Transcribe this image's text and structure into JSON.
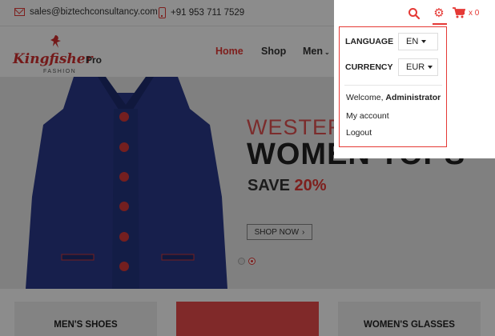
{
  "topbar": {
    "email": "sales@biztechconsultancy.com",
    "phone": "+91 953 711 7529"
  },
  "logo": {
    "brand": "Kingfisher",
    "pro": "Pro",
    "tagline": "FASHION"
  },
  "nav": {
    "items": [
      {
        "label": "Home",
        "active": true
      },
      {
        "label": "Shop",
        "active": false
      },
      {
        "label": "Men",
        "active": false
      }
    ]
  },
  "hero": {
    "tagline": "WESTERN",
    "headline": "WOMEN TOPS",
    "save_label": "SAVE",
    "save_percent": "20%",
    "button_label": "SHOP NOW",
    "slides": 2,
    "active_slide": 2
  },
  "categories": [
    {
      "label": "MEN'S SHOES"
    },
    {
      "label": ""
    },
    {
      "label": "WOMEN'S GLASSES"
    }
  ],
  "header_actions": {
    "cart_count": "x 0"
  },
  "dropdown": {
    "language_label": "LANGUAGE",
    "language_value": "EN",
    "currency_label": "CURRENCY",
    "currency_value": "EUR",
    "welcome_prefix": "Welcome,",
    "welcome_user": "Administrator",
    "my_account": "My account",
    "logout": "Logout"
  },
  "colors": {
    "accent": "#e53935",
    "overlay": "rgba(0,0,0,0.45)"
  }
}
